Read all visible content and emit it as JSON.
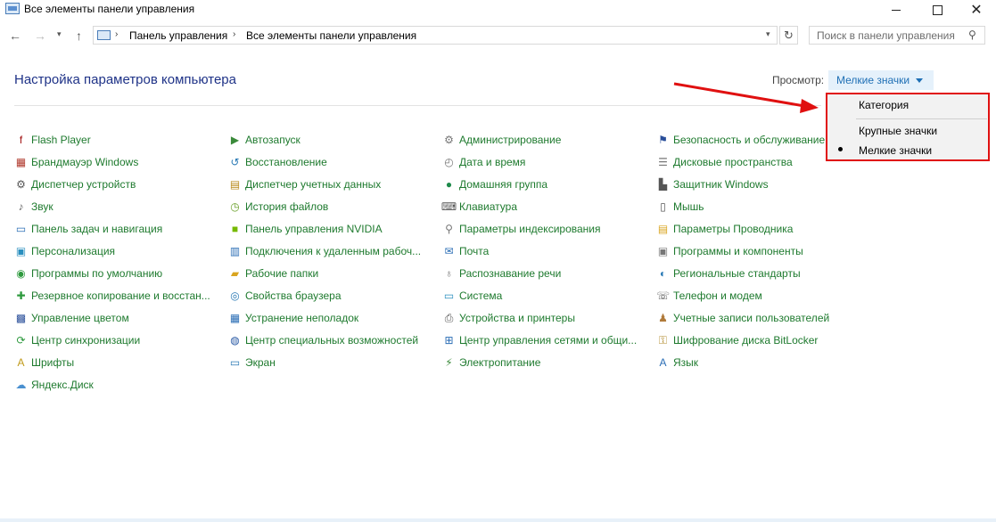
{
  "window": {
    "title": "Все элементы панели управления",
    "minimize": "—",
    "maximize": "☐",
    "close": "✕"
  },
  "nav": {
    "back": "←",
    "forward": "→",
    "recent": "▾",
    "up": "↑",
    "breadcrumb_sep": "›",
    "breadcrumbs": [
      "Панель управления",
      "Все элементы панели управления"
    ],
    "address_dropdown": "▾",
    "refresh": "↻",
    "search_placeholder": "Поиск в панели управления",
    "search_icon": "⚲"
  },
  "header": {
    "title": "Настройка параметров компьютера",
    "view_label": "Просмотр:",
    "view_value": "Мелкие значки"
  },
  "view_menu": {
    "options": [
      "Категория",
      "Крупные значки",
      "Мелкие значки"
    ],
    "selected": "Мелкие значки"
  },
  "colors": {
    "item_link": "#1e7a2e",
    "title": "#1e3287",
    "accent": "#1e6fb5",
    "highlight": "#e01010"
  },
  "columns": [
    [
      {
        "label": "Flash Player",
        "icon": "flash-player-icon",
        "glyph": "f",
        "color": "#a31616"
      },
      {
        "label": "Брандмауэр Windows",
        "icon": "firewall-icon",
        "glyph": "▦",
        "color": "#b03a2e"
      },
      {
        "label": "Диспетчер устройств",
        "icon": "device-manager-icon",
        "glyph": "⚙",
        "color": "#555555"
      },
      {
        "label": "Звук",
        "icon": "sound-icon",
        "glyph": "♪",
        "color": "#666666"
      },
      {
        "label": "Панель задач и навигация",
        "icon": "taskbar-icon",
        "glyph": "▭",
        "color": "#2a6db5"
      },
      {
        "label": "Персонализация",
        "icon": "personalization-icon",
        "glyph": "▣",
        "color": "#2a8fbf"
      },
      {
        "label": "Программы по умолчанию",
        "icon": "default-programs-icon",
        "glyph": "◉",
        "color": "#2e9a3e"
      },
      {
        "label": "Резервное копирование и восстан...",
        "icon": "backup-icon",
        "glyph": "✚",
        "color": "#2e9a3e"
      },
      {
        "label": "Управление цветом",
        "icon": "color-management-icon",
        "glyph": "▩",
        "color": "#2a4f9a"
      },
      {
        "label": "Центр синхронизации",
        "icon": "sync-center-icon",
        "glyph": "⟳",
        "color": "#2e9a3e"
      },
      {
        "label": "Шрифты",
        "icon": "fonts-icon",
        "glyph": "A",
        "color": "#c09a1a"
      },
      {
        "label": "Яндекс.Диск",
        "icon": "yandex-disk-icon",
        "glyph": "☁",
        "color": "#4a90d0"
      }
    ],
    [
      {
        "label": "Автозапуск",
        "icon": "autoplay-icon",
        "glyph": "▶",
        "color": "#3a8a3a"
      },
      {
        "label": "Восстановление",
        "icon": "recovery-icon",
        "glyph": "↺",
        "color": "#2a7ab5"
      },
      {
        "label": "Диспетчер учетных данных",
        "icon": "credential-manager-icon",
        "glyph": "▤",
        "color": "#b88a1a"
      },
      {
        "label": "История файлов",
        "icon": "file-history-icon",
        "glyph": "◷",
        "color": "#6aa02a"
      },
      {
        "label": "Панель управления NVIDIA",
        "icon": "nvidia-icon",
        "glyph": "■",
        "color": "#76b900"
      },
      {
        "label": "Подключения к удаленным рабоч...",
        "icon": "remote-desktop-icon",
        "glyph": "▥",
        "color": "#2a6db5"
      },
      {
        "label": "Рабочие папки",
        "icon": "work-folders-icon",
        "glyph": "▰",
        "color": "#d9a520"
      },
      {
        "label": "Свойства браузера",
        "icon": "browser-properties-icon",
        "glyph": "◎",
        "color": "#2a7ab5"
      },
      {
        "label": "Устранение неполадок",
        "icon": "troubleshooting-icon",
        "glyph": "▦",
        "color": "#2a6db5"
      },
      {
        "label": "Центр специальных возможностей",
        "icon": "ease-of-access-icon",
        "glyph": "◍",
        "color": "#2a5aa5"
      },
      {
        "label": "Экран",
        "icon": "display-icon",
        "glyph": "▭",
        "color": "#2a7ab5"
      }
    ],
    [
      {
        "label": "Администрирование",
        "icon": "administrative-tools-icon",
        "glyph": "⚙",
        "color": "#777777"
      },
      {
        "label": "Дата и время",
        "icon": "date-time-icon",
        "glyph": "◴",
        "color": "#777777"
      },
      {
        "label": "Домашняя группа",
        "icon": "homegroup-icon",
        "glyph": "●",
        "color": "#1e8a4a"
      },
      {
        "label": "Клавиатура",
        "icon": "keyboard-icon",
        "glyph": "⌨",
        "color": "#555555"
      },
      {
        "label": "Параметры индексирования",
        "icon": "indexing-options-icon",
        "glyph": "⚲",
        "color": "#777777"
      },
      {
        "label": "Почта",
        "icon": "mail-icon",
        "glyph": "✉",
        "color": "#2a6db5"
      },
      {
        "label": "Распознавание речи",
        "icon": "speech-recognition-icon",
        "glyph": "♁",
        "color": "#777777"
      },
      {
        "label": "Система",
        "icon": "system-icon",
        "glyph": "▭",
        "color": "#2a8fbf"
      },
      {
        "label": "Устройства и принтеры",
        "icon": "devices-printers-icon",
        "glyph": "⎙",
        "color": "#555555"
      },
      {
        "label": "Центр управления сетями и общи...",
        "icon": "network-center-icon",
        "glyph": "⊞",
        "color": "#2a6db5"
      },
      {
        "label": "Электропитание",
        "icon": "power-options-icon",
        "glyph": "⚡",
        "color": "#3a8a3a"
      }
    ],
    [
      {
        "label": "Безопасность и обслуживание",
        "icon": "security-maintenance-icon",
        "glyph": "⚑",
        "color": "#2a4f9a"
      },
      {
        "label": "Дисковые пространства",
        "icon": "storage-spaces-icon",
        "glyph": "☰",
        "color": "#777777"
      },
      {
        "label": "Защитник Windows",
        "icon": "windows-defender-icon",
        "glyph": "▙",
        "color": "#555555"
      },
      {
        "label": "Мышь",
        "icon": "mouse-icon",
        "glyph": "▯",
        "color": "#555555"
      },
      {
        "label": "Параметры Проводника",
        "icon": "explorer-options-icon",
        "glyph": "▤",
        "color": "#d9a520"
      },
      {
        "label": "Программы и компоненты",
        "icon": "programs-features-icon",
        "glyph": "▣",
        "color": "#777777"
      },
      {
        "label": "Региональные стандарты",
        "icon": "region-icon",
        "glyph": "◐",
        "color": "#2a7ab5"
      },
      {
        "label": "Телефон и модем",
        "icon": "phone-modem-icon",
        "glyph": "☏",
        "color": "#555555"
      },
      {
        "label": "Учетные записи пользователей",
        "icon": "user-accounts-icon",
        "glyph": "♟",
        "color": "#b07a3a"
      },
      {
        "label": "Шифрование диска BitLocker",
        "icon": "bitlocker-icon",
        "glyph": "⚿",
        "color": "#b08a2a"
      },
      {
        "label": "Язык",
        "icon": "language-icon",
        "glyph": "A",
        "color": "#2a6db5"
      }
    ]
  ]
}
